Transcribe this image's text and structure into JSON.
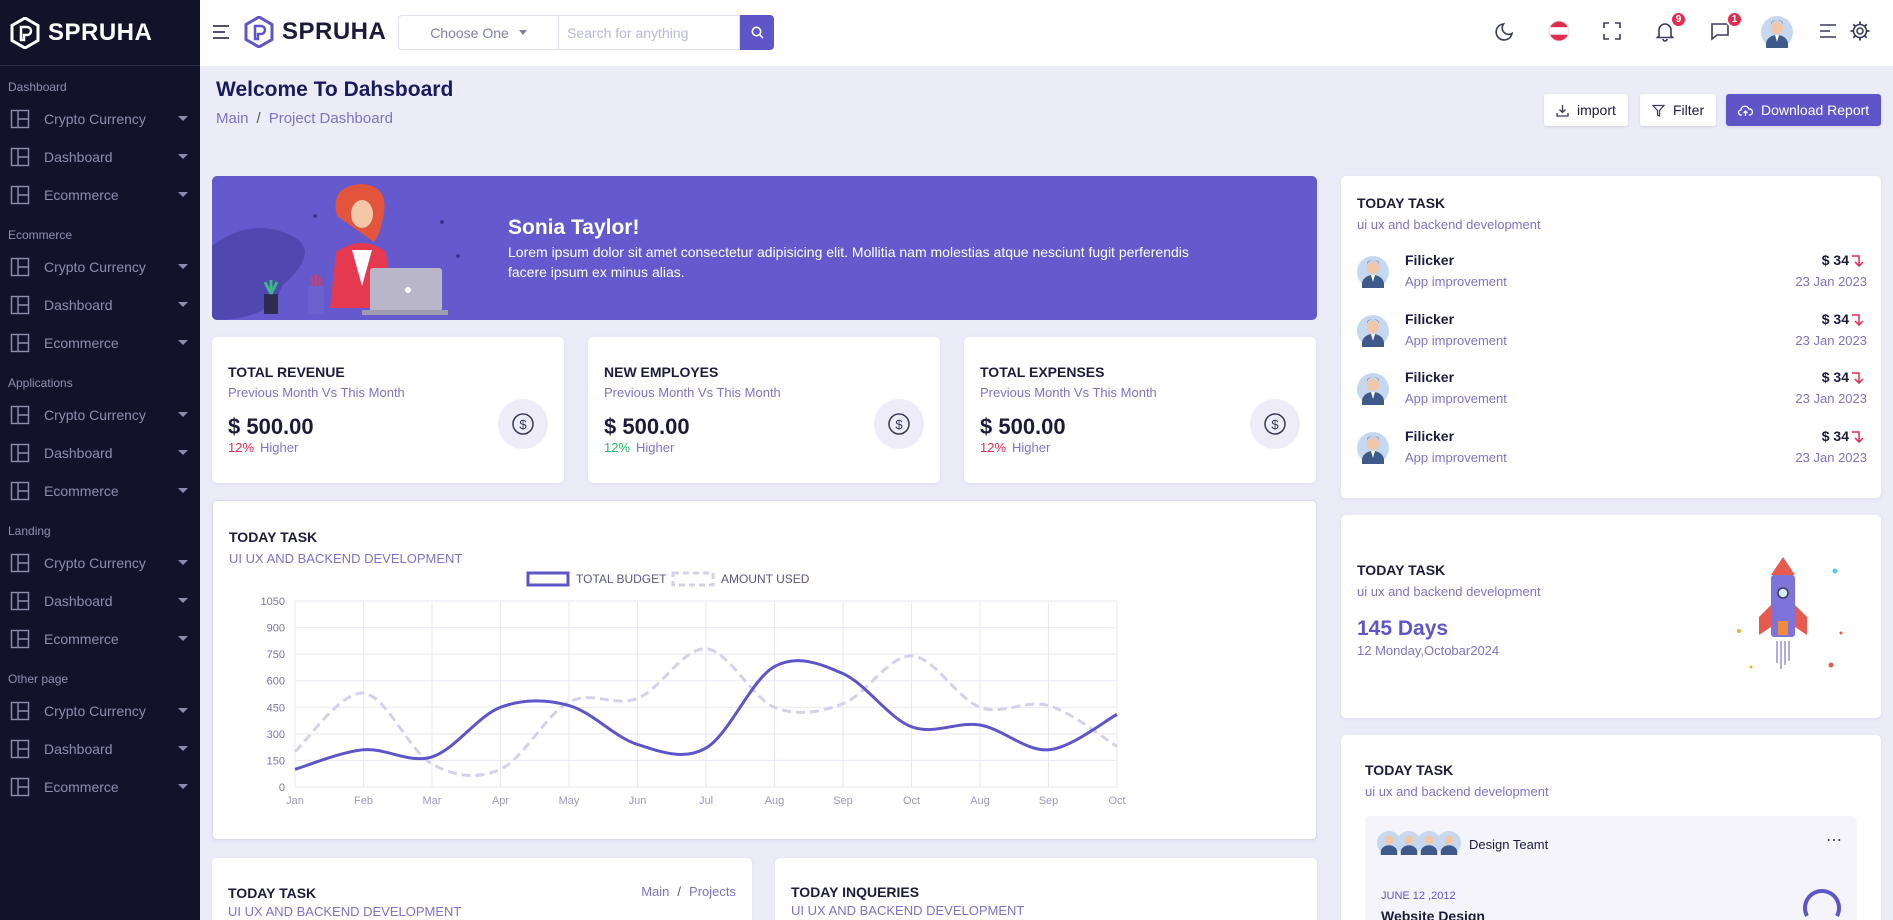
{
  "app": {
    "name": "SPRUHA"
  },
  "sidebar": {
    "sections": [
      {
        "title": "Dashboard",
        "items": [
          "Crypto Currency",
          "Dashboard",
          "Ecommerce"
        ]
      },
      {
        "title": "Ecommerce",
        "items": [
          "Crypto Currency",
          "Dashboard",
          "Ecommerce"
        ]
      },
      {
        "title": "Applications",
        "items": [
          "Crypto Currency",
          "Dashboard",
          "Ecommerce"
        ]
      },
      {
        "title": "Landing",
        "items": [
          "Crypto Currency",
          "Dashboard",
          "Ecommerce"
        ]
      },
      {
        "title": "Other page",
        "items": [
          "Crypto Currency",
          "Dashboard",
          "Ecommerce"
        ]
      }
    ]
  },
  "header": {
    "select_value": "Choose One",
    "search_placeholder": "Search for anything",
    "notifications_count": "9",
    "messages_count": "1",
    "icons": [
      "menu-icon",
      "search-icon",
      "moon-icon",
      "flag-icon",
      "fullscreen-icon",
      "bell-icon",
      "chat-icon",
      "avatar",
      "list-icon",
      "gear-icon"
    ]
  },
  "page": {
    "title": "Welcome To Dahsboard",
    "breadcrumb": [
      "Main",
      "Project Dashboard"
    ],
    "buttons": {
      "import": "import",
      "filter": "Filter",
      "download": "Download Report"
    }
  },
  "welcome": {
    "name": "Sonia Taylor!",
    "message": "Lorem ipsum dolor sit amet consectetur adipisicing elit. Mollitia nam molestias atque nesciunt fugit perferendis facere ipsum ex minus alias."
  },
  "stats": [
    {
      "title": "TOTAL REVENUE",
      "subtitle": "Previous Month Vs This Month",
      "value": "$ 500.00",
      "percent": "12%",
      "percent_color": "#e02c4e",
      "label": "Higher"
    },
    {
      "title": "NEW EMPLOYES",
      "subtitle": "Previous Month Vs This Month",
      "value": "$ 500.00",
      "percent": "12%",
      "percent_color": "#1fbf6a",
      "label": "Higher"
    },
    {
      "title": "TOTAL EXPENSES",
      "subtitle": "Previous Month Vs This Month",
      "value": "$ 500.00",
      "percent": "12%",
      "percent_color": "#e02c4e",
      "label": "Higher"
    }
  ],
  "chart_card": {
    "title": "TODAY TASK",
    "subtitle": "UI UX AND BACKEND DEVELOPMENT"
  },
  "chart_data": {
    "type": "line",
    "categories": [
      "Jan",
      "Feb",
      "Mar",
      "Apr",
      "May",
      "Jun",
      "Jul",
      "Aug",
      "Sep",
      "Oct",
      "Aug",
      "Sep",
      "Oct"
    ],
    "ylim": [
      0,
      1050
    ],
    "yticks": [
      0,
      150,
      300,
      450,
      600,
      750,
      900,
      1050
    ],
    "grid": true,
    "legend_position": "top-center",
    "series": [
      {
        "name": "TOTAL BUDGET",
        "color": "#5e55c9",
        "style": "solid",
        "values": [
          100,
          210,
          170,
          450,
          460,
          240,
          220,
          680,
          640,
          340,
          350,
          210,
          410
        ]
      },
      {
        "name": "AMOUNT USED",
        "color": "#d3d2ea",
        "style": "dashed",
        "values": [
          200,
          530,
          130,
          100,
          480,
          500,
          780,
          450,
          470,
          740,
          450,
          460,
          230
        ]
      }
    ]
  },
  "today_task": {
    "title": "TODAY TASK",
    "subtitle": "ui ux and backend development",
    "rows": [
      {
        "name": "Filicker",
        "desc": "App improvement",
        "price": "$ 34",
        "date": "23 Jan 2023"
      },
      {
        "name": "Filicker",
        "desc": "App improvement",
        "price": "$ 34",
        "date": "23 Jan 2023"
      },
      {
        "name": "Filicker",
        "desc": "App improvement",
        "price": "$ 34",
        "date": "23 Jan 2023"
      },
      {
        "name": "Filicker",
        "desc": "App improvement",
        "price": "$ 34",
        "date": "23 Jan 2023"
      }
    ]
  },
  "days_card": {
    "title": "TODAY TASK",
    "subtitle": "ui ux and backend development",
    "days": "145 Days",
    "date": "12 Monday,Octobar2024"
  },
  "team_card": {
    "title": "TODAY TASK",
    "subtitle": "ui ux and backend development",
    "team": "Design Teamt",
    "date": "JUNE 12 ,2012",
    "project": "Website Design"
  },
  "bottom_left": {
    "title": "TODAY TASK",
    "subtitle": "UI UX AND BACKEND DEVELOPMENT",
    "breadcrumb": [
      "Main",
      "Projects"
    ]
  },
  "bottom_mid": {
    "title": "TODAY INQUERIES",
    "subtitle": "UI UX AND BACKEND DEVELOPMENT"
  }
}
